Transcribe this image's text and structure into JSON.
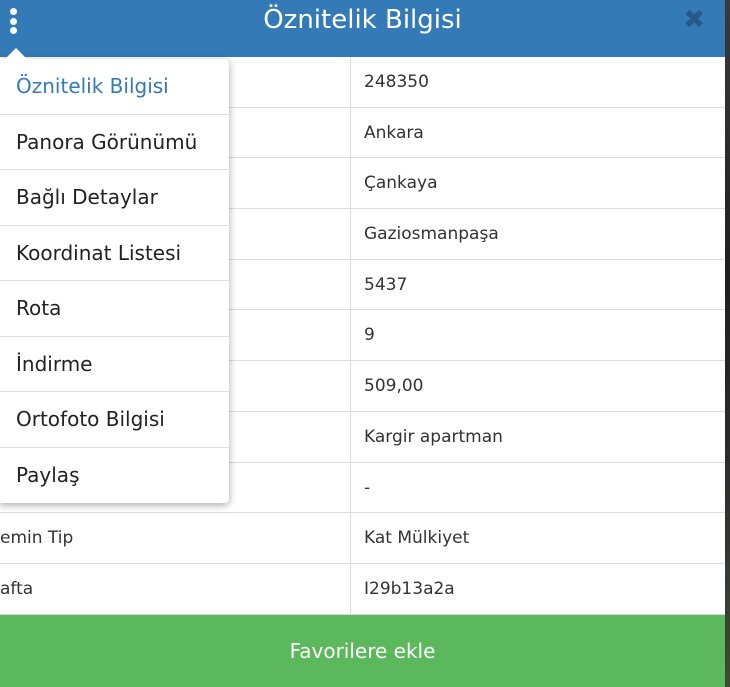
{
  "header": {
    "title": "Öznitelik Bilgisi"
  },
  "table": {
    "rows": [
      {
        "label": "",
        "value": "248350"
      },
      {
        "label": "",
        "value": "Ankara"
      },
      {
        "label": "",
        "value": "Çankaya"
      },
      {
        "label": "",
        "value": "Gaziosmanpaşa"
      },
      {
        "label": "",
        "value": "5437"
      },
      {
        "label": "",
        "value": "9"
      },
      {
        "label": "",
        "value": "509,00"
      },
      {
        "label": "",
        "value": "Kargir apartman"
      },
      {
        "label": "",
        "value": "-"
      },
      {
        "label": "emin Tip",
        "value": "Kat Mülkiyet"
      },
      {
        "label": "afta",
        "value": "I29b13a2a"
      }
    ]
  },
  "menu": {
    "items": [
      {
        "label": "Öznitelik Bilgisi",
        "active": true
      },
      {
        "label": "Panora Görünümü"
      },
      {
        "label": "Bağlı Detaylar"
      },
      {
        "label": "Koordinat Listesi"
      },
      {
        "label": "Rota"
      },
      {
        "label": "İndirme"
      },
      {
        "label": "Ortofoto Bilgisi"
      },
      {
        "label": "Paylaş"
      }
    ]
  },
  "footer": {
    "button_label": "Favorilere ekle"
  },
  "icons": {
    "menu": "kebab-menu-icon",
    "close": "close-icon"
  },
  "colors": {
    "header": "#337ab7",
    "footer": "#5cb85c",
    "active_menu": "#337ab7"
  }
}
